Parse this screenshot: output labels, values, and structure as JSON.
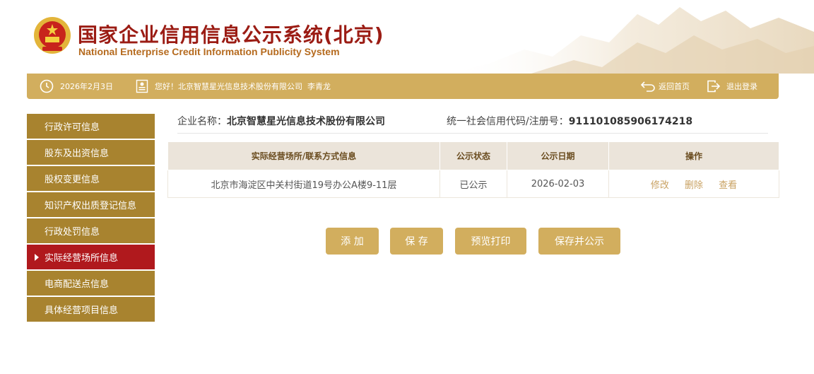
{
  "header": {
    "title_cn": "国家企业信用信息公示系统(北京)",
    "title_en": "National Enterprise Credit Information Publicity System",
    "emblem_icon": "national-emblem-icon"
  },
  "topbar": {
    "date": "2026年2月3日",
    "greeting": "您好！北京智慧星光信息技术股份有限公司  李青龙",
    "home_label": "返回首页",
    "logout_label": "退出登录"
  },
  "sidebar": {
    "items": [
      {
        "label": "行政许可信息"
      },
      {
        "label": "股东及出资信息"
      },
      {
        "label": "股权变更信息"
      },
      {
        "label": "知识产权出质登记信息"
      },
      {
        "label": "行政处罚信息"
      },
      {
        "label": "实际经营场所信息"
      },
      {
        "label": "电商配送点信息"
      },
      {
        "label": "具体经营项目信息"
      }
    ],
    "active_index": 5
  },
  "company": {
    "name_label": "企业名称：",
    "name": "北京智慧星光信息技术股份有限公司",
    "code_label": "统一社会信用代码/注册号：",
    "code": "911101085906174218"
  },
  "table": {
    "headers": [
      "实际经营场所/联系方式信息",
      "公示状态",
      "公示日期",
      "操作"
    ],
    "rows": [
      {
        "address": "北京市海淀区中关村街道19号办公A楼9-11层",
        "status": "已公示",
        "date": "2026-02-03",
        "ops": [
          "修改",
          "删除",
          "查看"
        ]
      }
    ]
  },
  "buttons": {
    "add": "添 加",
    "save": "保 存",
    "preview_print": "预览打印",
    "save_publish": "保存并公示"
  },
  "colors": {
    "gold": "#d2ae5e",
    "sidebar": "#a8832f",
    "active": "#b0191d",
    "title_red": "#9b1c14"
  }
}
